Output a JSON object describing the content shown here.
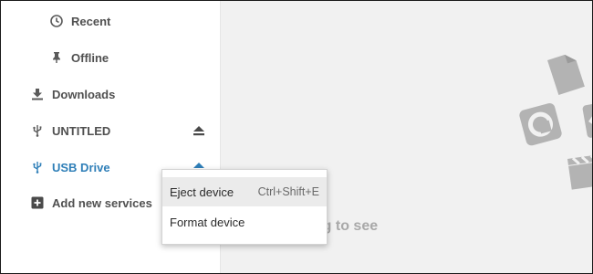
{
  "sidebar": {
    "items": [
      {
        "label": "Recent",
        "icon": "clock-icon"
      },
      {
        "label": "Offline",
        "icon": "pin-icon"
      },
      {
        "label": "Downloads",
        "icon": "download-icon"
      },
      {
        "label": "UNTITLED",
        "icon": "usb-icon"
      },
      {
        "label": "USB Drive",
        "icon": "usb-icon"
      },
      {
        "label": "Add new services",
        "icon": "add-box-icon"
      }
    ]
  },
  "context_menu": {
    "items": [
      {
        "label": "Eject device",
        "shortcut": "Ctrl+Shift+E"
      },
      {
        "label": "Format device"
      }
    ]
  },
  "main": {
    "empty_text": "Nothing to see"
  },
  "colors": {
    "accent": "#2f7fb8",
    "main_bg": "#f1f1f1",
    "icon_gray": "#b3b3b3"
  }
}
